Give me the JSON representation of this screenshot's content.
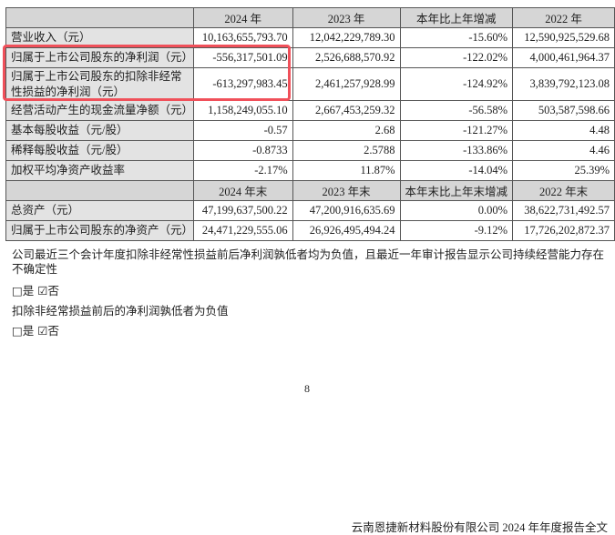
{
  "table1": {
    "headers": [
      "",
      "2024 年",
      "2023 年",
      "本年比上年增减",
      "2022 年"
    ],
    "rows": [
      [
        "营业收入（元）",
        "10,163,655,793.70",
        "12,042,229,789.30",
        "-15.60%",
        "12,590,925,529.68"
      ],
      [
        "归属于上市公司股东的净利润（元）",
        "-556,317,501.09",
        "2,526,688,570.92",
        "-122.02%",
        "4,000,461,964.37"
      ],
      [
        "归属于上市公司股东的扣除非经常性损益的净利润（元）",
        "-613,297,983.45",
        "2,461,257,928.99",
        "-124.92%",
        "3,839,792,123.08"
      ],
      [
        "经营活动产生的现金流量净额（元）",
        "1,158,249,055.10",
        "2,667,453,259.32",
        "-56.58%",
        "503,587,598.66"
      ],
      [
        "基本每股收益（元/股）",
        "-0.57",
        "2.68",
        "-121.27%",
        "4.48"
      ],
      [
        "稀释每股收益（元/股）",
        "-0.8733",
        "2.5788",
        "-133.86%",
        "4.46"
      ],
      [
        "加权平均净资产收益率",
        "-2.17%",
        "11.87%",
        "-14.04%",
        "25.39%"
      ]
    ]
  },
  "table2": {
    "headers": [
      "",
      "2024 年末",
      "2023 年末",
      "本年末比上年末增减",
      "2022 年末"
    ],
    "rows": [
      [
        "总资产（元）",
        "47,199,637,500.22",
        "47,200,916,635.69",
        "0.00%",
        "38,622,731,492.57"
      ],
      [
        "归属于上市公司股东的净资产（元）",
        "24,471,229,555.06",
        "26,926,495,494.24",
        "-9.12%",
        "17,726,202,872.37"
      ]
    ]
  },
  "notes": {
    "q1": "公司最近三个会计年度扣除非经常性损益前后净利润孰低者均为负值，且最近一年审计报告显示公司持续经营能力存在不确定性",
    "q1_answer": "□是 ☑否",
    "q2": "扣除非经常损益前后的净利润孰低者为负值",
    "q2_answer": "□是 ☑否"
  },
  "page_number": "8",
  "footer": "云南恩捷新材料股份有限公司 2024 年年度报告全文",
  "highlight_color": "#f0505a"
}
